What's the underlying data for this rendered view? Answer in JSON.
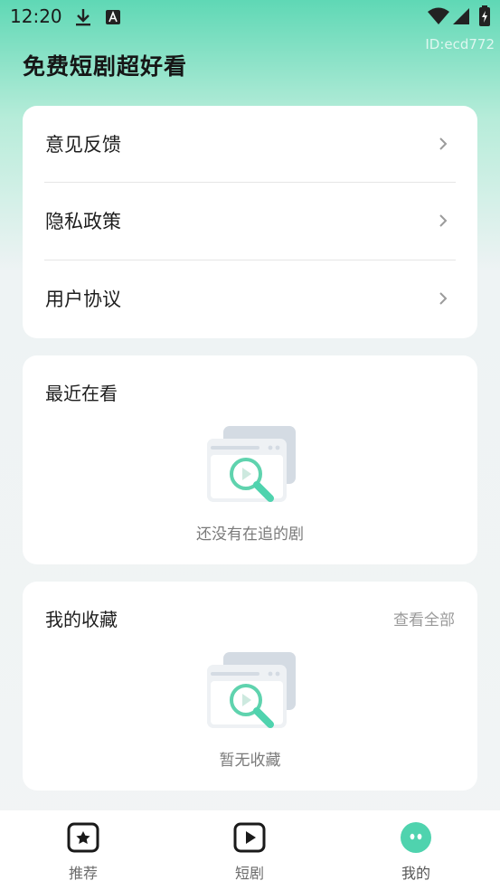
{
  "status": {
    "time": "12:20"
  },
  "watermark_id": "ID:ecd772",
  "app_title": "免费短剧超好看",
  "menu": [
    {
      "label": "意见反馈"
    },
    {
      "label": "隐私政策"
    },
    {
      "label": "用户协议"
    }
  ],
  "recent": {
    "title": "最近在看",
    "empty_text": "还没有在追的剧"
  },
  "favorites": {
    "title": "我的收藏",
    "view_all": "查看全部",
    "empty_text": "暂无收藏"
  },
  "tabs": [
    {
      "label": "推荐",
      "icon": "star-tv-icon"
    },
    {
      "label": "短剧",
      "icon": "play-icon"
    },
    {
      "label": "我的",
      "icon": "face-icon",
      "active": true
    }
  ],
  "colors": {
    "accent": "#5fd8b5",
    "active_tab": "#4fd3ae"
  }
}
